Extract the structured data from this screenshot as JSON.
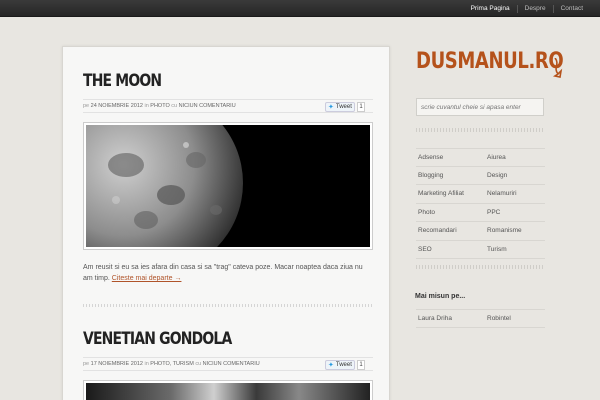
{
  "topnav": [
    "Prima Pagina",
    "Despre",
    "Contact"
  ],
  "logo": "DUSMANUL.RO",
  "search_placeholder": "scrie cuvantul cheie si apasa enter",
  "posts": [
    {
      "title": "The Moon",
      "meta_prefix": "pe",
      "date": "24 noiembrie 2012",
      "in_word": "in",
      "category": "Photo",
      "comments_word": "cu",
      "comments": "niciun comentariu",
      "tweet_label": "Tweet",
      "tweet_count": "1",
      "excerpt": "Am reusit si eu sa ies afara din casa si sa \"trag\" cateva poze. Macar noaptea daca ziua nu am timp.",
      "read_more": "Citeste mai departe →"
    },
    {
      "title": "Venetian Gondola",
      "meta_prefix": "pe",
      "date": "17 noiembrie 2012",
      "in_word": "in",
      "category": "Photo, Turism",
      "comments_word": "cu",
      "comments": "niciun comentariu",
      "tweet_label": "Tweet",
      "tweet_count": "1"
    }
  ],
  "categories": [
    [
      "Adsense",
      "Aiurea"
    ],
    [
      "Blogging",
      "Design"
    ],
    [
      "Marketing Afiliat",
      "Nelamuriri"
    ],
    [
      "Photo",
      "PPC"
    ],
    [
      "Recomandari",
      "Romanisme"
    ],
    [
      "SEO",
      "Turism"
    ]
  ],
  "widget_title": "Mai misun pe...",
  "links": [
    "Laura Driha",
    "Robintel"
  ],
  "colors": {
    "accent": "#b5521b",
    "topbar": "#2e2e2e"
  }
}
